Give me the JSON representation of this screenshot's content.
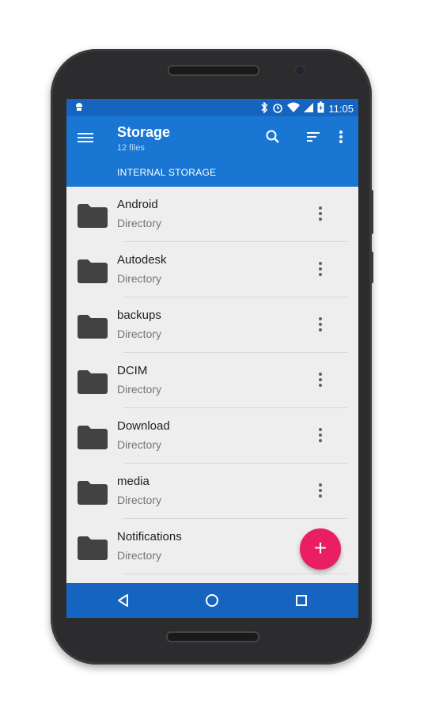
{
  "status_bar": {
    "time": "11:05",
    "icons": [
      "android-icon",
      "bluetooth-icon",
      "alarm-icon",
      "wifi-icon",
      "signal-icon",
      "battery-charging-icon"
    ]
  },
  "app_bar": {
    "title": "Storage",
    "subtitle": "12 files",
    "tab_label": "INTERNAL STORAGE",
    "actions": [
      "search-icon",
      "sort-icon",
      "overflow-menu-icon"
    ]
  },
  "files": [
    {
      "name": "Android",
      "type": "Directory"
    },
    {
      "name": "Autodesk",
      "type": "Directory"
    },
    {
      "name": "backups",
      "type": "Directory"
    },
    {
      "name": "DCIM",
      "type": "Directory"
    },
    {
      "name": "Download",
      "type": "Directory"
    },
    {
      "name": "media",
      "type": "Directory"
    },
    {
      "name": "Notifications",
      "type": "Directory"
    }
  ],
  "fab": {
    "label": "+"
  },
  "colors": {
    "primary": "#1976d2",
    "primary_dark": "#1565c0",
    "accent": "#e91e63",
    "background": "#eeeeee"
  }
}
